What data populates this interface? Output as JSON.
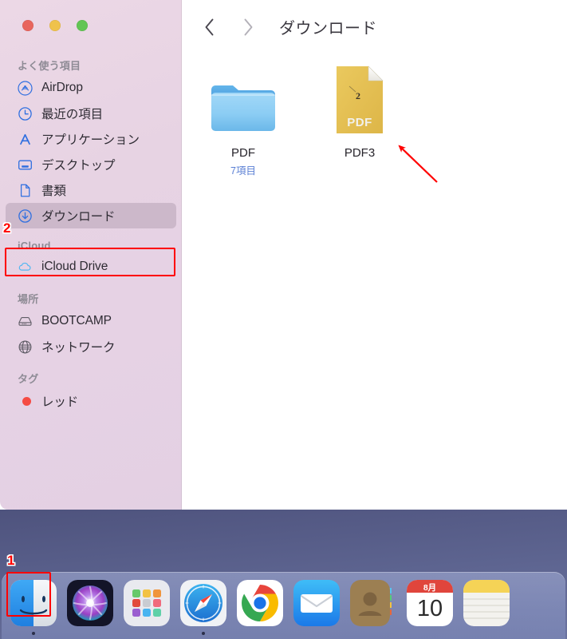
{
  "window": {
    "title": "ダウンロード",
    "traffic_lights": [
      {
        "name": "close",
        "color": "#e8655d"
      },
      {
        "name": "minimize",
        "color": "#efc24c"
      },
      {
        "name": "zoom",
        "color": "#62c554"
      }
    ],
    "nav": {
      "back": "‹",
      "forward": "›"
    }
  },
  "sidebar": {
    "sections": [
      {
        "header": "よく使う項目",
        "items": [
          {
            "label": "AirDrop",
            "icon": "airdrop-icon",
            "selected": false
          },
          {
            "label": "最近の項目",
            "icon": "clock-icon",
            "selected": false
          },
          {
            "label": "アプリケーション",
            "icon": "applications-icon",
            "selected": false
          },
          {
            "label": "デスクトップ",
            "icon": "desktop-icon",
            "selected": false
          },
          {
            "label": "書類",
            "icon": "document-icon",
            "selected": false
          },
          {
            "label": "ダウンロード",
            "icon": "downloads-icon",
            "selected": true
          }
        ]
      },
      {
        "header": "iCloud",
        "items": [
          {
            "label": "iCloud Drive",
            "icon": "cloud-icon",
            "selected": false
          }
        ]
      },
      {
        "header": "場所",
        "items": [
          {
            "label": "BOOTCAMP",
            "icon": "hard-drive-icon",
            "selected": false
          },
          {
            "label": "ネットワーク",
            "icon": "globe-icon",
            "selected": false
          }
        ]
      },
      {
        "header": "タグ",
        "items": [
          {
            "label": "レッド",
            "icon": "red-tag-dot",
            "selected": false
          }
        ]
      }
    ]
  },
  "content": {
    "files": [
      {
        "name": "PDF",
        "subtitle": "7項目",
        "icon": "folder-icon",
        "selected": false
      },
      {
        "name": "PDF3",
        "subtitle": "",
        "icon": "pdf-file-icon",
        "selected": false
      }
    ]
  },
  "dock": {
    "items": [
      {
        "label": "Finder",
        "icon": "finder-icon",
        "running": true
      },
      {
        "label": "Siri",
        "icon": "siri-icon",
        "running": false
      },
      {
        "label": "Launchpad",
        "icon": "launchpad-icon",
        "running": false
      },
      {
        "label": "Safari",
        "icon": "safari-icon",
        "running": true
      },
      {
        "label": "Chrome",
        "icon": "chrome-icon",
        "running": false
      },
      {
        "label": "メール",
        "icon": "mail-icon",
        "running": false
      },
      {
        "label": "連絡先",
        "icon": "contacts-icon",
        "running": false
      },
      {
        "label": "カレンダー",
        "icon": "calendar-icon",
        "running": false,
        "calendar_month": "8月",
        "calendar_day": "10"
      },
      {
        "label": "メモ",
        "icon": "notes-icon",
        "running": false
      }
    ]
  },
  "annotations": {
    "marker_1": "1",
    "marker_2": "2",
    "highlight_color": "#ff0000",
    "arrow": "red-arrow-pointing-to-pdf3"
  }
}
